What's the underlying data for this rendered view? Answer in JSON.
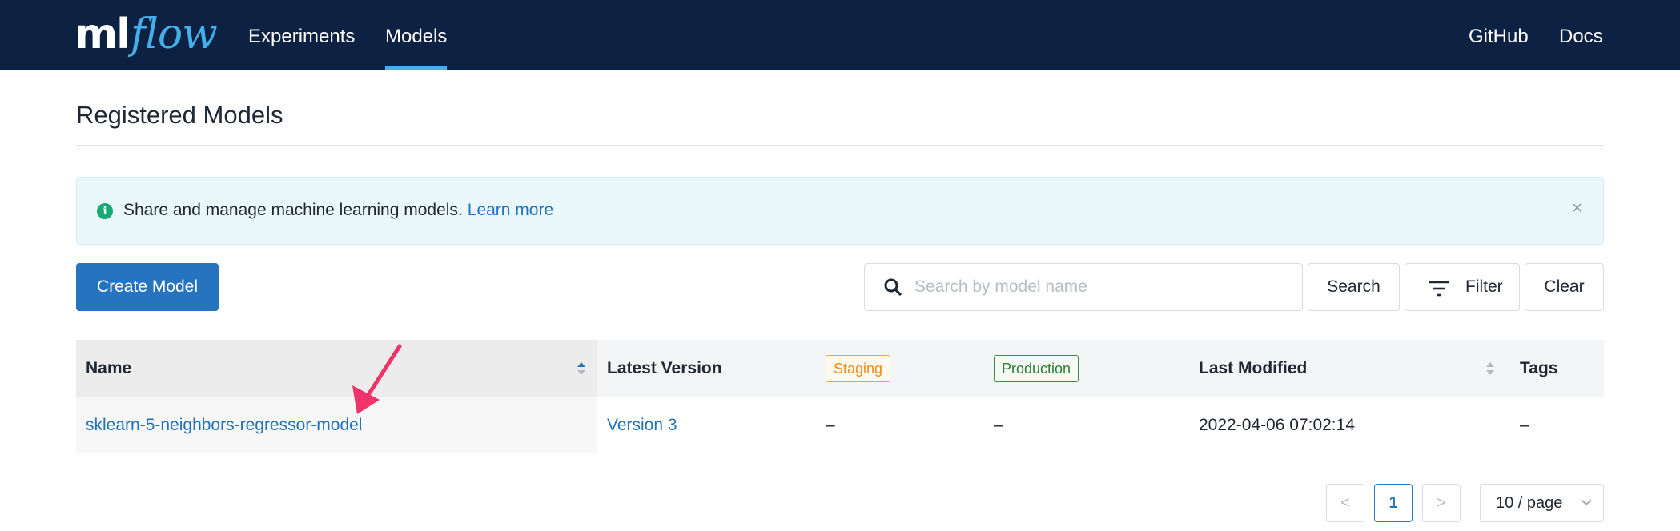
{
  "header": {
    "logo_ml": "ml",
    "logo_flow": "flow",
    "nav": [
      {
        "label": "Experiments",
        "active": false
      },
      {
        "label": "Models",
        "active": true
      }
    ],
    "right_links": [
      "GitHub",
      "Docs"
    ]
  },
  "page": {
    "title": "Registered Models"
  },
  "banner": {
    "icon": "info-icon",
    "text": "Share and manage machine learning models.",
    "link": "Learn more",
    "close": "×"
  },
  "toolbar": {
    "create_label": "Create Model",
    "search_placeholder": "Search by model name",
    "search_value": "",
    "search_button": "Search",
    "filter_button": "Filter",
    "clear_button": "Clear"
  },
  "table": {
    "columns": {
      "name": "Name",
      "latest_version": "Latest Version",
      "staging": "Staging",
      "production": "Production",
      "last_modified": "Last Modified",
      "tags": "Tags"
    },
    "rows": [
      {
        "name": "sklearn-5-neighbors-regressor-model",
        "latest_version": "Version 3",
        "staging": "–",
        "production": "–",
        "last_modified": "2022-04-06 07:02:14",
        "tags": "–"
      }
    ]
  },
  "pagination": {
    "prev": "<",
    "current_page": "1",
    "next": ">",
    "page_size": "10 / page"
  },
  "colors": {
    "header_bg": "#0d2142",
    "accent": "#43b0ea",
    "primary": "#2674c0",
    "link": "#2072b9",
    "annotation_arrow": "#f0336b"
  }
}
